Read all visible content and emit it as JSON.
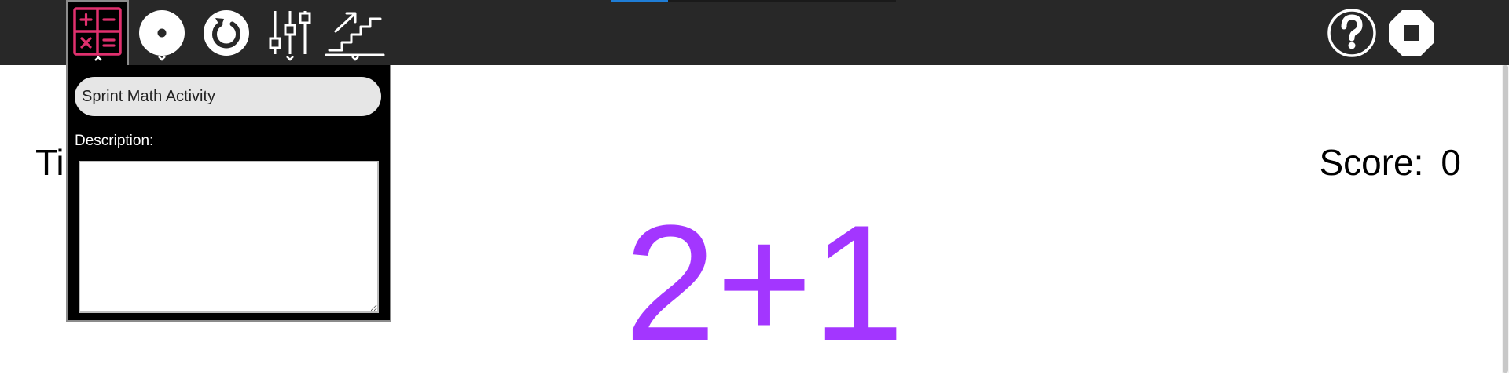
{
  "toolbar": {
    "buttons": [
      {
        "name": "activity",
        "icon": "calculator-icon",
        "expanded": true
      },
      {
        "name": "play",
        "icon": "dot-circle-icon"
      },
      {
        "name": "restart",
        "icon": "restart-icon"
      },
      {
        "name": "settings",
        "icon": "sliders-icon"
      },
      {
        "name": "level",
        "icon": "stairs-icon"
      }
    ],
    "right_buttons": [
      {
        "name": "help",
        "icon": "help-icon"
      },
      {
        "name": "stop",
        "icon": "stop-icon"
      }
    ],
    "progress_fraction": 0.2,
    "colors": {
      "background": "#282828",
      "icon": "#ffffff",
      "activity_icon": "#e0306e",
      "progress": "#1f7dd6"
    }
  },
  "activity_popup": {
    "title_value": "Sprint Math Activity",
    "description_label": "Description:",
    "description_value": ""
  },
  "game": {
    "timer_label": "Ti",
    "score_label": "Score:",
    "score_value": "0",
    "problem": "2+1",
    "problem_color": "#a336ff"
  }
}
